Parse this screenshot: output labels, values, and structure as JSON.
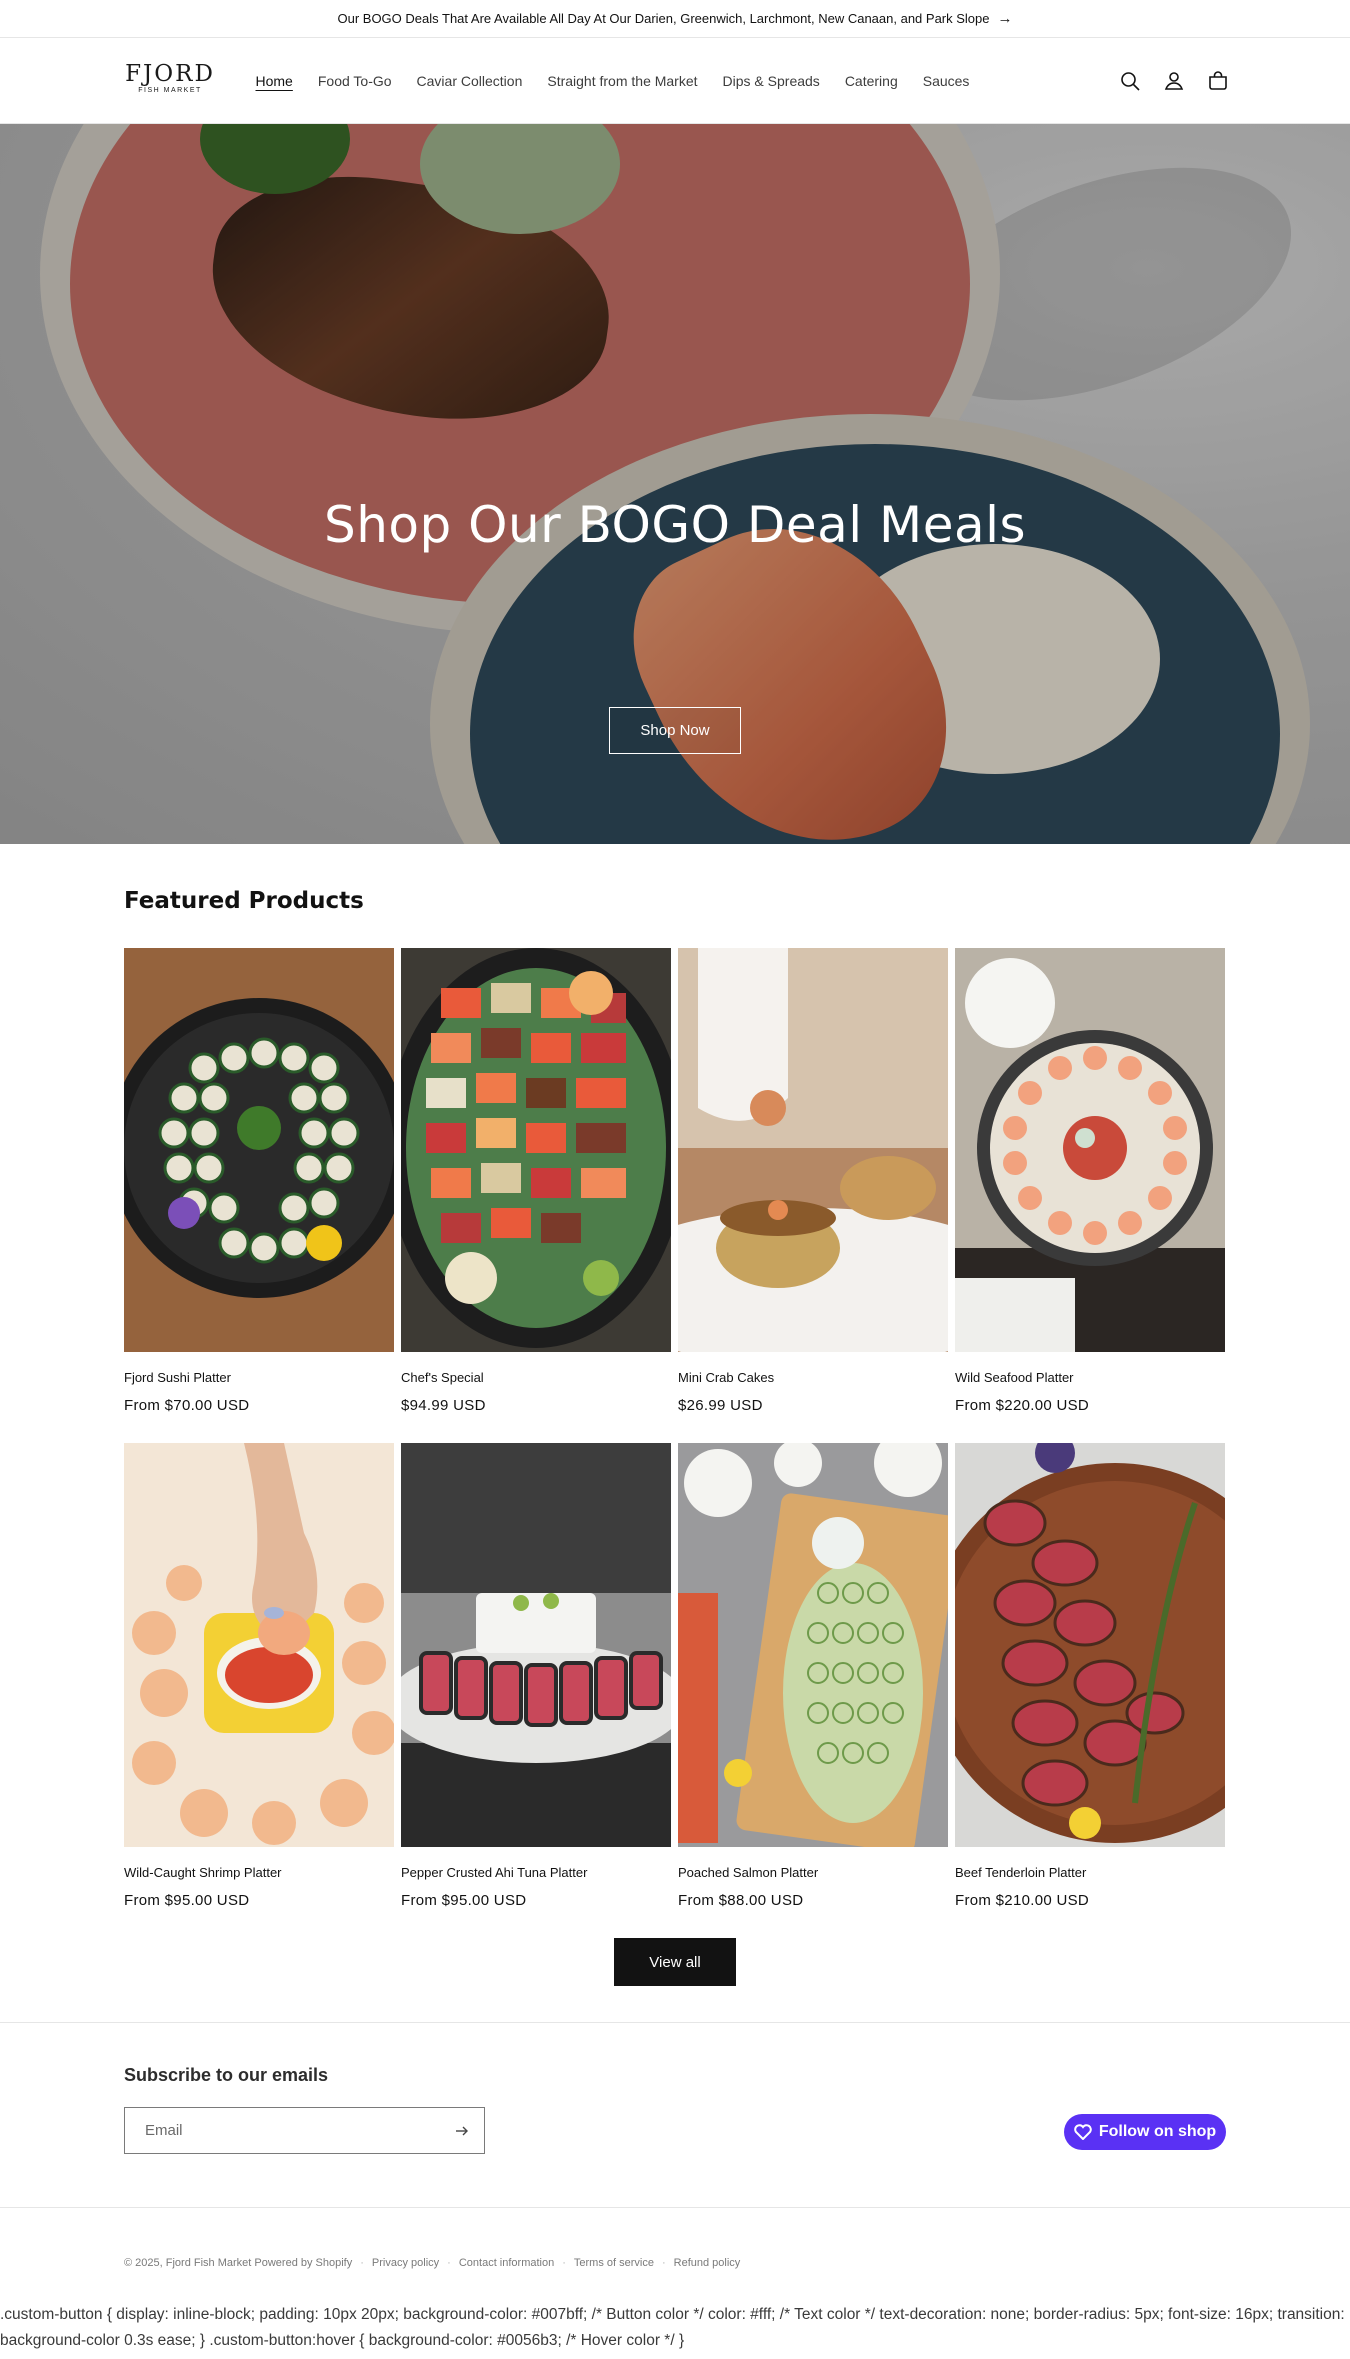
{
  "announcement": {
    "text": "Our BOGO Deals That Are Available All Day At Our Darien, Greenwich, Larchmont, New Canaan, and Park Slope",
    "arrow": "→"
  },
  "header": {
    "logo_main": "FJORD",
    "logo_sub": "FISH MARKET",
    "nav": [
      "Home",
      "Food To-Go",
      "Caviar Collection",
      "Straight from the Market",
      "Dips & Spreads",
      "Catering",
      "Sauces"
    ],
    "icons": [
      "search-icon",
      "account-icon",
      "cart-icon"
    ]
  },
  "hero": {
    "title": "Shop Our BOGO Deal Meals",
    "button": "Shop Now"
  },
  "featured": {
    "title": "Featured Products",
    "products": [
      {
        "name": "Fjord Sushi Platter",
        "price": "From $70.00 USD"
      },
      {
        "name": "Chef's Special",
        "price": "$94.99 USD"
      },
      {
        "name": "Mini Crab Cakes",
        "price": "$26.99 USD"
      },
      {
        "name": "Wild Seafood Platter",
        "price": "From $220.00 USD"
      },
      {
        "name": "Wild-Caught Shrimp Platter",
        "price": "From $95.00 USD"
      },
      {
        "name": "Pepper Crusted Ahi Tuna Platter",
        "price": "From $95.00 USD"
      },
      {
        "name": "Poached Salmon Platter",
        "price": "From $88.00 USD"
      },
      {
        "name": "Beef Tenderloin Platter",
        "price": "From $210.00 USD"
      }
    ],
    "view_all": "View all"
  },
  "subscribe": {
    "title": "Subscribe to our emails",
    "placeholder": "Email",
    "follow_label": "Follow on shop"
  },
  "footer": {
    "copyright": "© 2025,",
    "brand": "Fjord Fish Market",
    "powered": "Powered by Shopify",
    "links": [
      "Privacy policy",
      "Contact information",
      "Terms of service",
      "Refund policy"
    ]
  },
  "css_dump": ".custom-button { display: inline-block; padding: 10px 20px; background-color: #007bff; /* Button color */ color: #fff; /* Text color */ text-decoration: none; border-radius: 5px; font-size: 16px; transition: background-color 0.3s ease; } .custom-button:hover { background-color: #0056b3; /* Hover color */ }",
  "colors": {
    "follow_shop": "#5a31f4",
    "dark_button": "#121212"
  }
}
